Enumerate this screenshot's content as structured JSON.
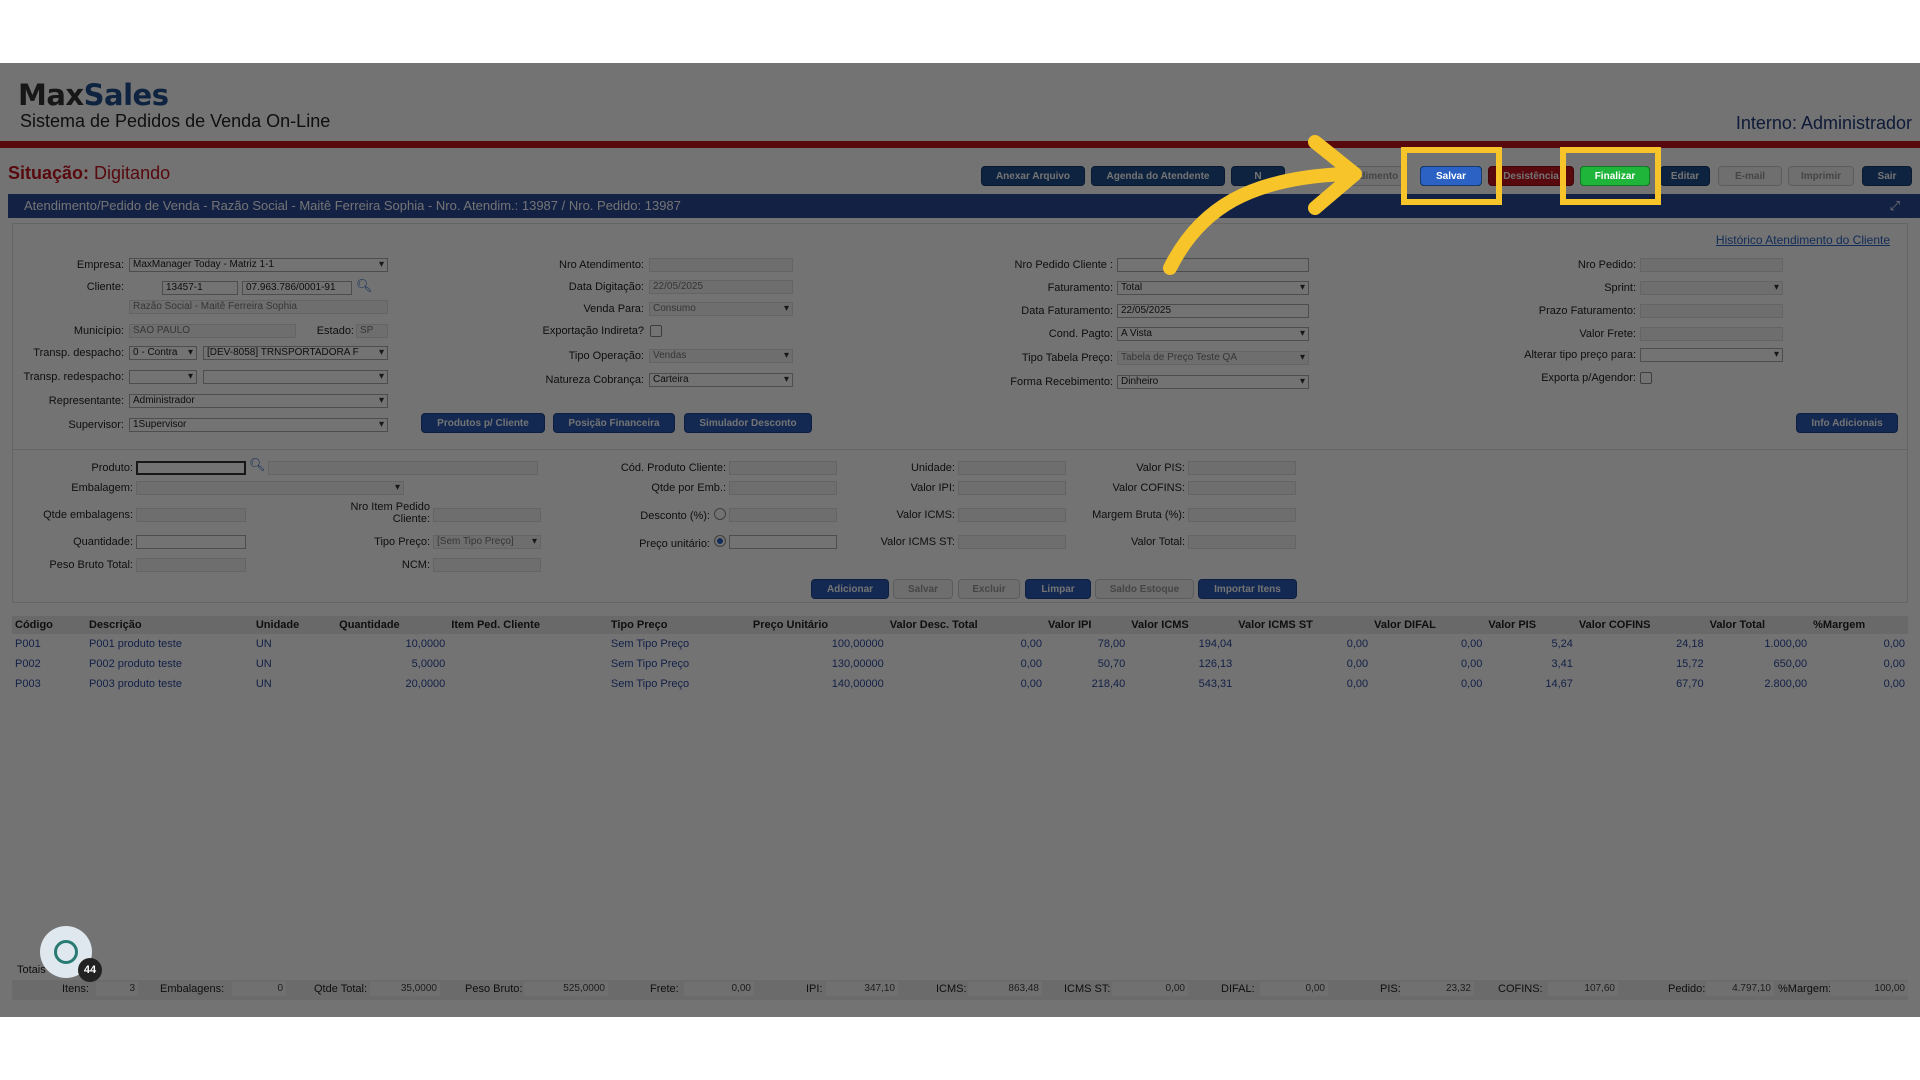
{
  "header": {
    "logo_max": "Max",
    "logo_sales": "Sales",
    "subtitle": "Sistema de Pedidos de Venda On-Line",
    "user": "Interno: Administrador",
    "status_label": "Situação:",
    "status_value": "Digitando"
  },
  "toolbar": {
    "anexar": "Anexar Arquivo",
    "agenda": "Agenda do Atendente",
    "n": "N",
    "atendimento": "endimento",
    "salvar": "Salvar",
    "desistencia": "Desistência",
    "finalizar": "Finalizar",
    "editar": "Editar",
    "email": "E-mail",
    "imprimir": "Imprimir",
    "sair": "Sair"
  },
  "bar": {
    "title": "Atendimento/Pedido de Venda - Razão Social - Maitê Ferreira Sophia - Nro. Atendim.: 13987 / Nro. Pedido: 13987",
    "expand": "⤢"
  },
  "form": {
    "historico": "Histórico Atendimento do Cliente",
    "empresa_label": "Empresa:",
    "empresa_value": "MaxManager Today - Matriz 1-1",
    "cliente_label": "Cliente:",
    "cliente_code": "13457-1",
    "cliente_cnpj": "07.963.786/0001-91",
    "cliente_razao": "Razão Social - Maitê Ferreira Sophia",
    "municipio_label": "Município:",
    "municipio_value": "SAO PAULO",
    "estado_label": "Estado:",
    "estado_value": "SP",
    "transp_despacho_label": "Transp. despacho:",
    "transp_despacho_a": "0 - Contra",
    "transp_despacho_b": "[DEV-8058] TRNSPORTADORA F",
    "transp_redespacho_label": "Transp. redespacho:",
    "representante_label": "Representante:",
    "representante_value": "Administrador",
    "supervisor_label": "Supervisor:",
    "supervisor_value": "1Supervisor",
    "nro_atendimento_label": "Nro Atendimento:",
    "data_digitacao_label": "Data Digitação:",
    "data_digitacao_value": "22/05/2025",
    "venda_para_label": "Venda Para:",
    "venda_para_value": "Consumo",
    "exportacao_label": "Exportação Indireta?",
    "tipo_operacao_label": "Tipo Operação:",
    "tipo_operacao_value": "Vendas",
    "natureza_label": "Natureza Cobrança:",
    "natureza_value": "Carteira",
    "nro_pedido_cliente_label": "Nro Pedido Cliente :",
    "faturamento_label": "Faturamento:",
    "faturamento_value": "Total",
    "data_faturamento_label": "Data Faturamento:",
    "data_faturamento_value": "22/05/2025",
    "cond_pagto_label": "Cond. Pagto:",
    "cond_pagto_value": "A Vista",
    "tipo_tabela_label": "Tipo Tabela Preço:",
    "tipo_tabela_value": "Tabela de Preço Teste QA",
    "forma_recebimento_label": "Forma Recebimento:",
    "forma_recebimento_value": "Dinheiro",
    "nro_pedido_label": "Nro Pedido:",
    "sprint_label": "Sprint:",
    "prazo_label": "Prazo Faturamento:",
    "valor_frete_label": "Valor Frete:",
    "alterar_tipo_label": "Alterar tipo preço para:",
    "exporta_label": "Exporta p/Agendor:",
    "btn_produtos": "Produtos p/ Cliente",
    "btn_posicao": "Posição Financeira",
    "btn_simulador": "Simulador Desconto",
    "btn_info": "Info Adicionais"
  },
  "item_form": {
    "produto_label": "Produto:",
    "embalagem_label": "Embalagem:",
    "qtde_emb_label": "Qtde embalagens:",
    "nro_item_label_1": "Nro Item Pedido",
    "nro_item_label_2": "Cliente:",
    "quantidade_label": "Quantidade:",
    "tipo_preco_label": "Tipo Preço:",
    "tipo_preco_value": "[Sem Tipo Preço]",
    "peso_bruto_label": "Peso Bruto Total:",
    "ncm_label": "NCM:",
    "cod_prod_cliente_label": "Cód. Produto Cliente:",
    "qtde_por_emb_label": "Qtde por Emb.:",
    "desconto_label": "Desconto (%):",
    "preco_unitario_label": "Preço unitário:",
    "unidade_label": "Unidade:",
    "valor_ipi_label": "Valor IPI:",
    "valor_icms_label": "Valor ICMS:",
    "valor_icms_st_label": "Valor ICMS ST:",
    "valor_pis_label": "Valor PIS:",
    "valor_cofins_label": "Valor COFINS:",
    "margem_bruta_label": "Margem Bruta (%):",
    "valor_total_label": "Valor Total:",
    "btn_adicionar": "Adicionar",
    "btn_salvar": "Salvar",
    "btn_excluir": "Excluir",
    "btn_limpar": "Limpar",
    "btn_saldo": "Saldo Estoque",
    "btn_importar": "Importar Itens"
  },
  "table": {
    "headers": [
      "Código",
      "Descrição",
      "Unidade",
      "Quantidade",
      "Item Ped. Cliente",
      "Tipo Preço",
      "Preço Unitário",
      "Valor Desc. Total",
      "Valor IPI",
      "Valor ICMS",
      "Valor ICMS ST",
      "Valor DIFAL",
      "Valor PIS",
      "Valor COFINS",
      "Valor Total",
      "%Margem"
    ],
    "rows": [
      [
        "P001",
        "P001 produto teste",
        "UN",
        "10,0000",
        "",
        "Sem Tipo Preço",
        "100,00000",
        "0,00",
        "78,00",
        "194,04",
        "0,00",
        "0,00",
        "5,24",
        "24,18",
        "1.000,00",
        "0,00"
      ],
      [
        "P002",
        "P002 produto teste",
        "UN",
        "5,0000",
        "",
        "Sem Tipo Preço",
        "130,00000",
        "0,00",
        "50,70",
        "126,13",
        "0,00",
        "0,00",
        "3,41",
        "15,72",
        "650,00",
        "0,00"
      ],
      [
        "P003",
        "P003 produto teste",
        "UN",
        "20,0000",
        "",
        "Sem Tipo Preço",
        "140,00000",
        "0,00",
        "218,40",
        "543,31",
        "0,00",
        "0,00",
        "14,67",
        "67,70",
        "2.800,00",
        "0,00"
      ]
    ]
  },
  "totals": {
    "label": "Totais",
    "itens_label": "Itens:",
    "itens": "3",
    "embalagens_label": "Embalagens:",
    "embalagens": "0",
    "qtde_label": "Qtde Total:",
    "qtde": "35,0000",
    "peso_label": "Peso Bruto:",
    "peso": "525,0000",
    "frete_label": "Frete:",
    "frete": "0,00",
    "ipi_label": "IPI:",
    "ipi": "347,10",
    "icms_label": "ICMS:",
    "icms": "863,48",
    "icms_st_label": "ICMS ST:",
    "icms_st": "0,00",
    "difal_label": "DIFAL:",
    "difal": "0,00",
    "pis_label": "PIS:",
    "pis": "23,32",
    "cofins_label": "COFINS:",
    "cofins": "107,60",
    "pedido_label": "Pedido:",
    "pedido": "4.797,10",
    "margem_label": "%Margem:",
    "margem": "100,00"
  },
  "chat": {
    "badge": "44"
  },
  "colors": {
    "highlight": "#f7c52a",
    "brand": "#1f4e8c",
    "accent_red": "#c0141f",
    "finalizar": "#1fb53b"
  }
}
